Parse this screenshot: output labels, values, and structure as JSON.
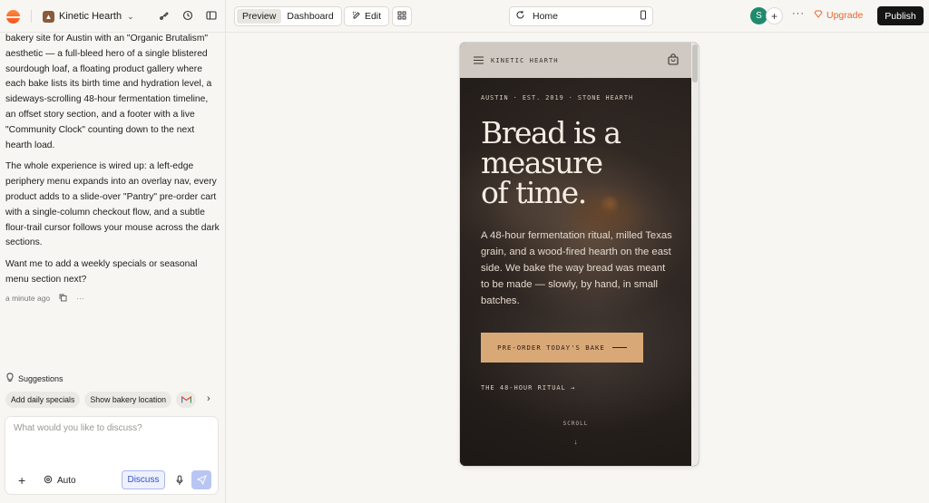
{
  "project": {
    "name": "Kinetic Hearth"
  },
  "toolbar": {
    "preview": "Preview",
    "dashboard": "Dashboard",
    "edit": "Edit",
    "url_page": "Home",
    "avatar_initial": "S",
    "upgrade": "Upgrade",
    "publish": "Publish"
  },
  "chat": {
    "p1": "bakery site for Austin with an \"Organic Brutalism\" aesthetic — a full-bleed hero of a single blistered sourdough loaf, a floating product gallery where each bake lists its birth time and hydration level, a sideways-scrolling 48-hour fermentation timeline, an offset story section, and a footer with a live \"Community Clock\" counting down to the next hearth load.",
    "p2": "The whole experience is wired up: a left-edge periphery menu expands into an overlay nav, every product adds to a slide-over \"Pantry\" pre-order cart with a single-column checkout flow, and a subtle flour-trail cursor follows your mouse across the dark sections.",
    "p3": "Want me to add a weekly specials or seasonal menu section next?",
    "timestamp": "a minute ago",
    "suggestions_title": "Suggestions",
    "suggestions": [
      "Add daily specials",
      "Show bakery location"
    ],
    "composer_placeholder": "What would you like to discuss?",
    "mode": "Auto",
    "discuss": "Discuss"
  },
  "site": {
    "brand": "KINETIC HEARTH",
    "eyebrow": "AUSTIN · EST. 2019 · STONE HEARTH",
    "headline_1": "Bread is a",
    "headline_2": "measure",
    "headline_3": "of time.",
    "lede": "A 48-hour fermentation ritual, milled Texas grain, and a wood-fired hearth on the east side. We bake the way bread was meant to be made — slowly, by hand, in small batches.",
    "cta": "PRE-ORDER TODAY'S BAKE",
    "ritual_link": "THE 48-HOUR RITUAL →",
    "scroll": "SCROLL"
  },
  "colors": {
    "accent": "#d9a877",
    "upgrade": "#e8662f",
    "publish_bg": "#151515",
    "avatar": "#1f8a6e",
    "discuss": "#3450c8"
  },
  "icons": [
    "logo-icon",
    "project-icon",
    "chevron-down-icon",
    "paint-icon",
    "history-icon",
    "sidebar-icon",
    "edit-icon",
    "grid-icon",
    "refresh-icon",
    "device-icon",
    "more-icon",
    "upgrade-icon",
    "copy-icon",
    "lightbulb-icon",
    "gmail-icon",
    "chevron-right-icon",
    "plus-icon",
    "settings-icon",
    "mic-icon",
    "send-icon",
    "menu-icon",
    "cart-icon",
    "arrow-down-icon"
  ]
}
